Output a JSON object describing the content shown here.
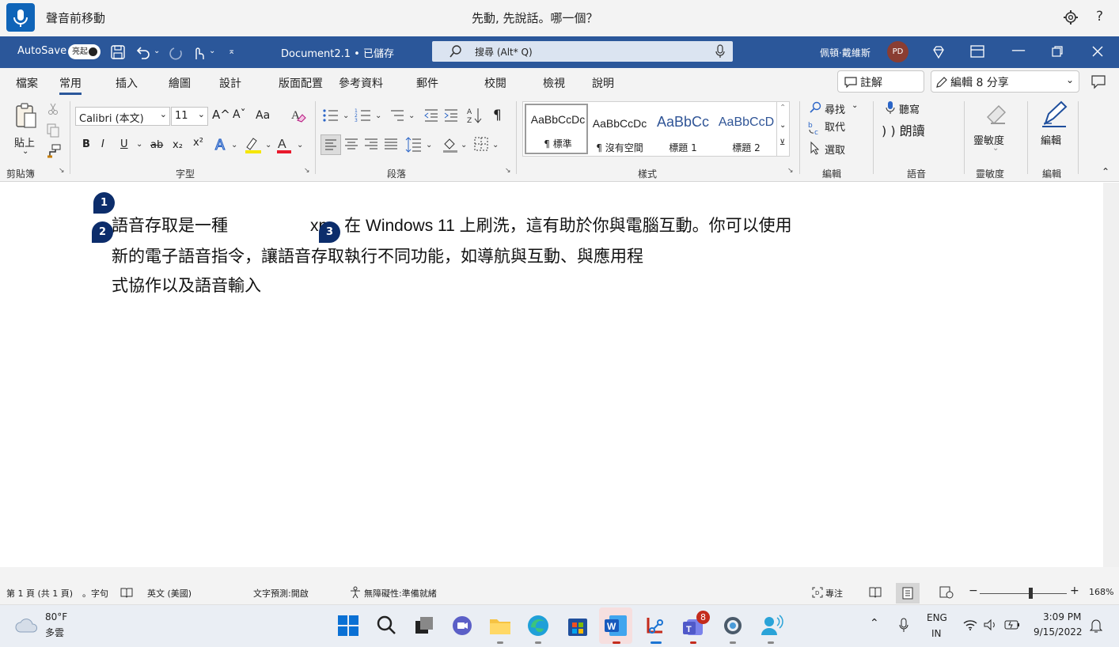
{
  "voice_access": {
    "app_title": "聲音前移動",
    "message": "先動, 先說話。哪一個？"
  },
  "word_title": {
    "autosave_label": "AutoSave",
    "autosave_state": "亮起",
    "document_name": "Document2.1 • 已儲存",
    "search_placeholder": "搜尋 (Alt* Q)",
    "user_name": "佩頓·戴維斯",
    "user_initials": "PD"
  },
  "tabs": [
    "檔案",
    "常用",
    "插入",
    "繪圖",
    "設計",
    "版面配置",
    "參考資料",
    "郵件",
    "校閱",
    "檢視",
    "說明"
  ],
  "active_tab": "常用",
  "tab_actions": {
    "comments": "註解",
    "editing": "編輯 8 分享"
  },
  "ribbon": {
    "clipboard": {
      "paste": "貼上",
      "label": "剪貼簿"
    },
    "font": {
      "font_name": "Calibri (本文)",
      "font_size": "11",
      "label": "字型",
      "bold": "B",
      "italic": "I",
      "underline": "U",
      "strike": "ab",
      "subscript": "x₂",
      "superscript": "x²",
      "grow": "A^",
      "shrink": "Aˇ",
      "case": "Aa"
    },
    "paragraph": {
      "label": "段落",
      "pilcrow": "¶"
    },
    "styles": {
      "label": "樣式",
      "items": [
        {
          "sample": "AaBbCcDc",
          "name": "¶ 標準"
        },
        {
          "sample": "AaBbCcDc",
          "name": "¶ 沒有空間"
        },
        {
          "sample": "AaBbCc",
          "name": "標題 1"
        },
        {
          "sample": "AaBbCcD",
          "name": "標題 2"
        }
      ]
    },
    "editing": {
      "find": "尋找",
      "replace": "取代",
      "select": "選取",
      "label": "編輯"
    },
    "voice": {
      "dictate": "聽寫",
      "read_aloud": ") ) 朗讀",
      "label": "語音"
    },
    "sensitivity": {
      "button": "靈敏度",
      "label": "靈敏度"
    },
    "editor": {
      "button": "編輯",
      "label": "編輯"
    }
  },
  "document": {
    "line1_start": "語音存取是一種",
    "line1_end": "xp。在 Windows 11 上刷洗，這有助於你與電腦互動。你可以使用",
    "line2": "新的電子語音指令，讓語音存取執行不同功能，如導航與互動、與應用程",
    "line3": "式協作以及語音輸入",
    "badges": [
      "1",
      "2",
      "3"
    ]
  },
  "status": {
    "page": "第 1 頁 (共 1 頁)",
    "words": "。字句",
    "language": "英文 (美國)",
    "prediction": "文字預測:開啟",
    "accessibility": "無障礙性:準備就緒",
    "focus": "專注",
    "zoom": "168%"
  },
  "taskbar": {
    "weather_temp": "80°F",
    "weather_desc": "多雲",
    "teams_badge": "8",
    "lang_top": "ENG",
    "lang_bottom": "IN",
    "time": "3:09 PM",
    "date": "9/15/2022"
  },
  "colors": {
    "word_blue": "#2b579a",
    "badge_navy": "#0c2d6b",
    "voice_blue": "#0f64b8"
  }
}
